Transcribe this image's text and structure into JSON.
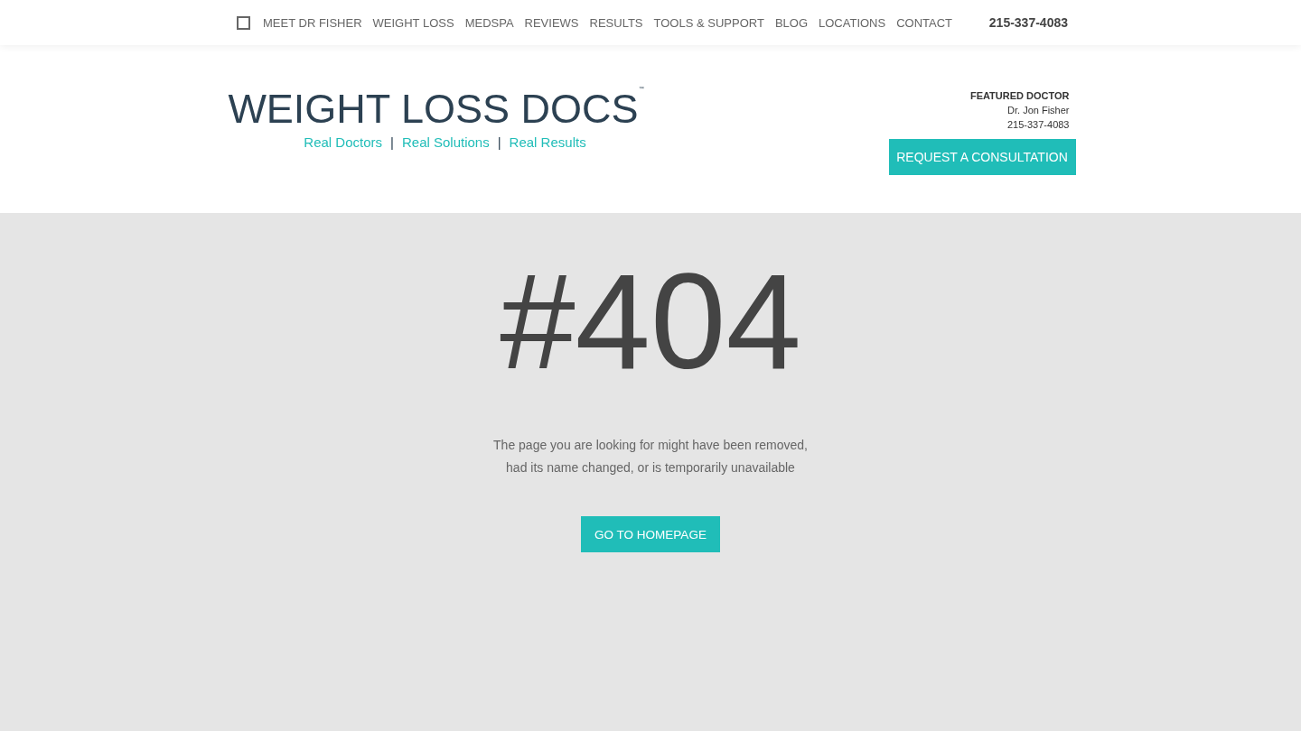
{
  "nav": {
    "items": [
      "MEET DR FISHER",
      "WEIGHT LOSS",
      "MEDSPA",
      "REVIEWS",
      "RESULTS",
      "TOOLS & SUPPORT",
      "BLOG",
      "LOCATIONS",
      "CONTACT"
    ],
    "phone": "215-337-4083"
  },
  "header": {
    "logo": {
      "name": "WEIGHT LOSS DOCS",
      "trademark": "™",
      "taglines": [
        "Real Doctors",
        "Real Solutions",
        "Real Results"
      ],
      "separator": "|"
    },
    "featured": {
      "heading": "FEATURED DOCTOR",
      "doctor": "Dr. Jon Fisher",
      "phone": "215-337-4083"
    },
    "cta": "REQUEST A CONSULTATION"
  },
  "error": {
    "code": "#404",
    "message_lines": [
      "The page you are looking for might have been removed,",
      "had its name changed, or is temporarily unavailable"
    ],
    "button": "GO TO HOMEPAGE"
  }
}
